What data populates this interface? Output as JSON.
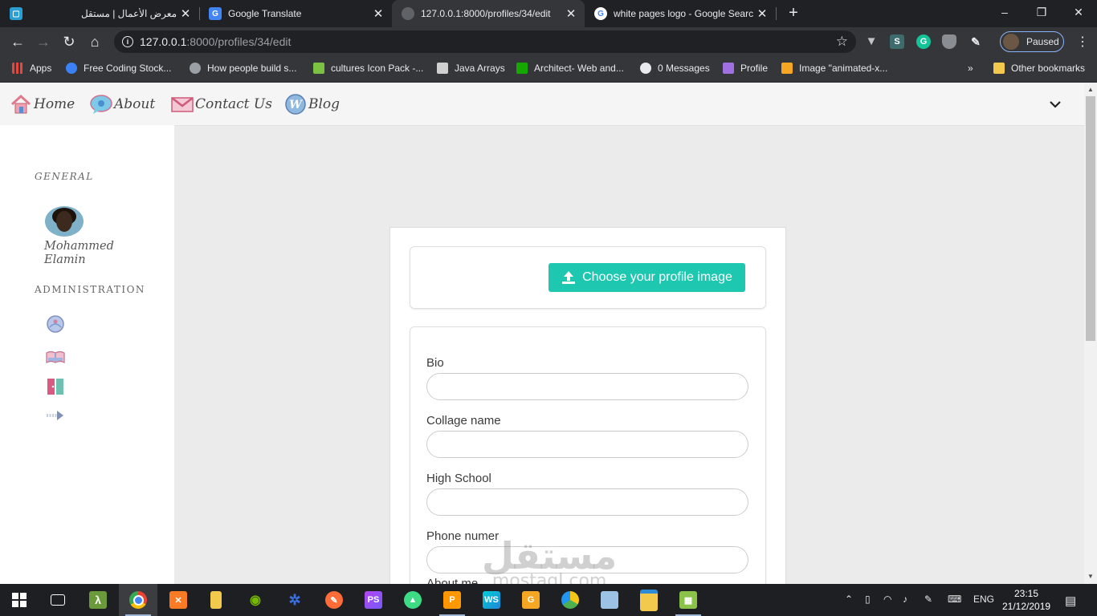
{
  "browser": {
    "tabs": [
      {
        "title": "معرض الأعمال | مستقل",
        "active": false,
        "favicon_color": "#2a9fd6"
      },
      {
        "title": "Google Translate",
        "active": false,
        "favicon_color": "#4285f4"
      },
      {
        "title": "127.0.0.1:8000/profiles/34/edit",
        "active": true,
        "favicon_color": "#9aa0a6"
      },
      {
        "title": "white pages logo - Google Search",
        "active": false,
        "favicon_color": "#ffffff"
      }
    ],
    "new_tab_symbol": "+",
    "window": {
      "minimize": "–",
      "restore": "❐",
      "close": "✕"
    },
    "url": {
      "host": "127.0.0.1",
      "path": ":8000/profiles/34/edit"
    },
    "profile_label": "Paused",
    "bookmarks": [
      {
        "label": "Apps",
        "color": "#e8453c"
      },
      {
        "label": "Free Coding Stock...",
        "color": "#3b82f6"
      },
      {
        "label": "How people build s...",
        "color": "#9aa0a6"
      },
      {
        "label": "cultures Icon Pack -...",
        "color": "#7cc143"
      },
      {
        "label": "Java Arrays",
        "color": "#d0d0d0"
      },
      {
        "label": "Architect- Web and...",
        "color": "#14a800"
      },
      {
        "label": "0 Messages",
        "color": "#e8eaed"
      },
      {
        "label": "Profile",
        "color": "#a070e0"
      },
      {
        "label": "Image \"animated-x...",
        "color": "#f5a623"
      }
    ],
    "bookmarks_overflow": "»",
    "other_bookmarks": "Other bookmarks"
  },
  "site": {
    "nav": [
      {
        "label": "Home",
        "icon": "house-icon"
      },
      {
        "label": "About",
        "icon": "speech-bubble-icon"
      },
      {
        "label": "Contact Us",
        "icon": "envelope-icon"
      },
      {
        "label": "Blog",
        "icon": "wordpress-icon"
      }
    ],
    "sidebar": {
      "general_heading": "GENERAL",
      "user_name": "Mohammed Elamin",
      "admin_heading": "ADMINISTRATION",
      "admin_icons": [
        "globe-icon",
        "book-icon",
        "door-icon",
        "arrow-right-icon"
      ]
    },
    "form": {
      "upload_label": "Choose your profile image",
      "fields": [
        {
          "label": "Bio",
          "value": ""
        },
        {
          "label": "Collage name",
          "value": ""
        },
        {
          "label": "High School",
          "value": ""
        },
        {
          "label": "Phone numer",
          "value": ""
        },
        {
          "label": "About me",
          "value": ""
        }
      ]
    },
    "watermark": {
      "main": "مستقل",
      "sub": "mostaql.com"
    }
  },
  "taskbar": {
    "apps": [
      "start-icon",
      "task-view-icon",
      "lambda-icon",
      "chrome-icon",
      "xampp-icon",
      "file-explorer-pin-icon",
      "nvidia-icon",
      "network-app-icon",
      "postman-icon",
      "phpstorm-icon",
      "android-studio-icon",
      "sublime-icon",
      "webstorm-icon",
      "glary-icon",
      "chrome-canary-icon",
      "gallery-icon",
      "explorer-icon",
      "excel-dev-icon"
    ],
    "language": "ENG",
    "time": "23:15",
    "date": "21/12/2019"
  }
}
